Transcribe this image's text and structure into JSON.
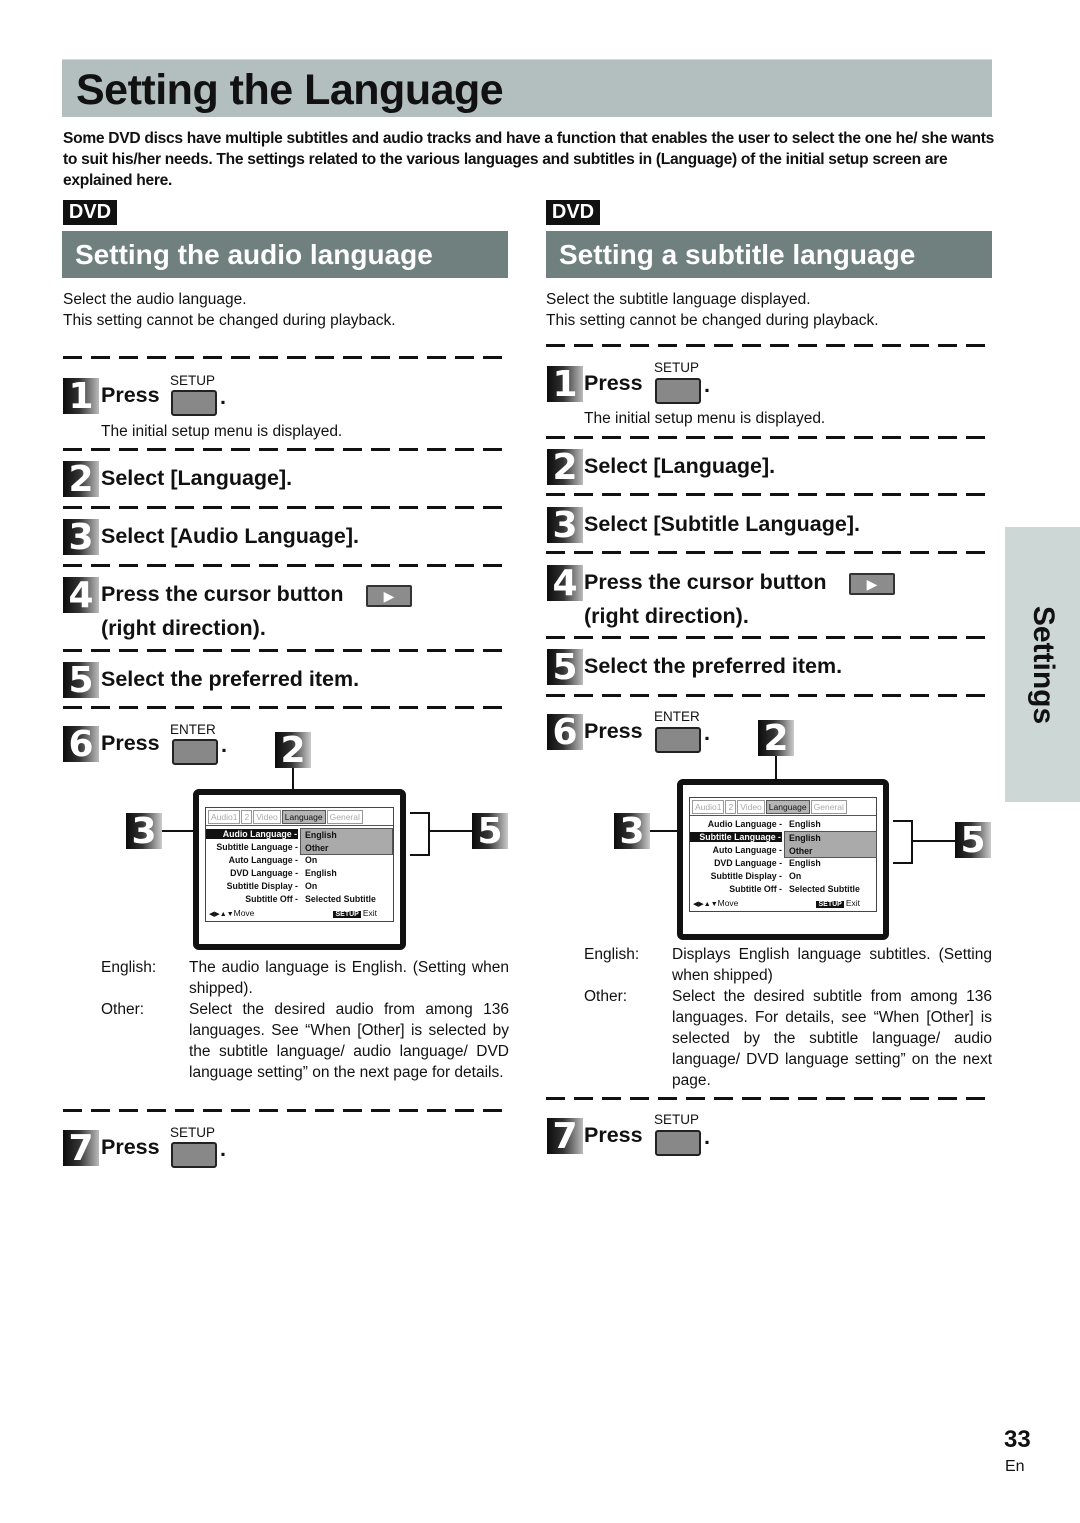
{
  "page": {
    "title": "Setting the Language",
    "intro": "Some DVD discs have multiple subtitles and audio tracks and have a function that enables the user to select the one he/ she wants to suit his/her needs. The settings related to the various languages and subtitles in (Language) of the initial setup screen are explained here.",
    "side_tab": "Settings",
    "page_number": "33",
    "page_lang": "En"
  },
  "left": {
    "badge": "DVD",
    "heading": "Setting the audio language",
    "desc1": "Select the audio language.",
    "desc2": "This setting cannot be changed during playback.",
    "steps": [
      {
        "num": "1",
        "text": "Press",
        "button_label": "SETUP",
        "sub": "The initial setup menu is displayed."
      },
      {
        "num": "2",
        "text": "Select [Language]."
      },
      {
        "num": "3",
        "text": "Select [Audio Language]."
      },
      {
        "num": "4",
        "text": "Press the cursor button",
        "text2": "(right direction).",
        "cursor_glyph": "▶"
      },
      {
        "num": "5",
        "text": "Select the preferred item."
      },
      {
        "num": "6",
        "text": "Press",
        "button_label": "ENTER"
      },
      {
        "num": "7",
        "text": "Press",
        "button_label": "SETUP"
      }
    ],
    "options": [
      {
        "key": "English:",
        "value": "The audio language is English. (Setting when shipped)."
      },
      {
        "key": "Other:",
        "value": "Select the desired audio from among 136 languages.  See “When [Other] is selected by the subtitle language/ audio language/ DVD language setting” on the next page for details."
      }
    ],
    "callouts": [
      "2",
      "3",
      "5"
    ]
  },
  "right": {
    "badge": "DVD",
    "heading": "Setting a subtitle language",
    "desc1": "Select the subtitle language displayed.",
    "desc2": "This setting cannot be changed during playback.",
    "steps": [
      {
        "num": "1",
        "text": "Press",
        "button_label": "SETUP",
        "sub": "The initial setup menu is displayed."
      },
      {
        "num": "2",
        "text": "Select [Language]."
      },
      {
        "num": "3",
        "text": "Select [Subtitle Language]."
      },
      {
        "num": "4",
        "text": "Press the cursor button",
        "text2": "(right direction).",
        "cursor_glyph": "▶"
      },
      {
        "num": "5",
        "text": "Select the preferred item."
      },
      {
        "num": "6",
        "text": "Press",
        "button_label": "ENTER"
      },
      {
        "num": "7",
        "text": "Press",
        "button_label": "SETUP"
      }
    ],
    "options": [
      {
        "key": "English:",
        "value": "Displays English language subtitles. (Setting when shipped)"
      },
      {
        "key": "Other:",
        "value": "Select the desired subtitle from among 136 languages. For details, see “When [Other] is selected by the subtitle language/ audio language/ DVD language setting” on the next page."
      }
    ],
    "callouts": [
      "2",
      "3",
      "5"
    ]
  },
  "osd": {
    "tabs": [
      "Audio1",
      "2",
      "Video",
      "Language",
      "General"
    ],
    "active_tab": "Language",
    "rows_left": [
      {
        "label": "Audio Language -",
        "value": ""
      },
      {
        "label": "Subtitle Language -",
        "value": ""
      },
      {
        "label": "Auto Language -",
        "value": "On"
      },
      {
        "label": "DVD Language -",
        "value": "English"
      },
      {
        "label": "Subtitle Display -",
        "value": "On"
      },
      {
        "label": "Subtitle Off -",
        "value": "Selected Subtitle"
      }
    ],
    "rows_right": [
      {
        "label": "Audio Language -",
        "value": "English"
      },
      {
        "label": "Subtitle Language -",
        "value": ""
      },
      {
        "label": "Auto Language -",
        "value": ""
      },
      {
        "label": "DVD Language -",
        "value": "English"
      },
      {
        "label": "Subtitle Display -",
        "value": "On"
      },
      {
        "label": "Subtitle Off -",
        "value": "Selected Subtitle"
      }
    ],
    "dropdown": [
      "English",
      "Other"
    ],
    "move_label": "Move",
    "move_glyphs": "◀▶▲▼",
    "setup_chip": "SETUP",
    "exit_label": "Exit"
  }
}
